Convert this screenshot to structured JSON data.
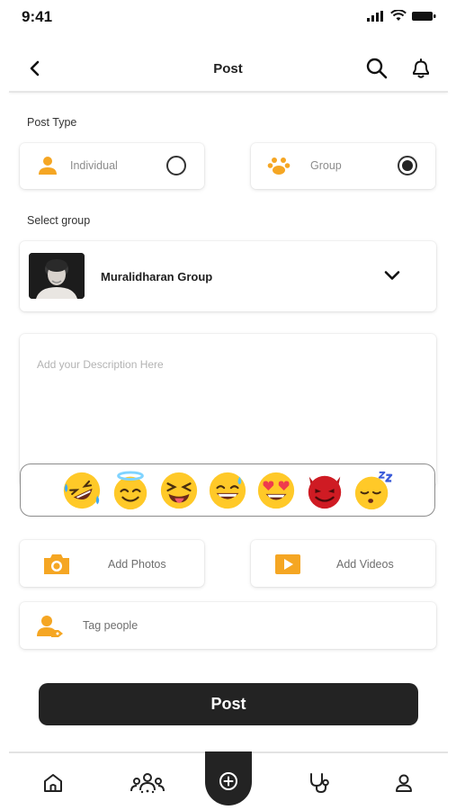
{
  "status_bar": {
    "time": "9:41"
  },
  "header": {
    "title": "Post"
  },
  "post_type": {
    "label": "Post Type",
    "options": [
      {
        "label": "Individual",
        "selected": false,
        "icon": "person-icon"
      },
      {
        "label": "Group",
        "selected": true,
        "icon": "group-paw-icon"
      }
    ]
  },
  "group": {
    "label": "Select group",
    "selected_name": "Muralidharan Group"
  },
  "description": {
    "placeholder": "Add your Description Here"
  },
  "emojis": [
    "rolling-laugh",
    "smiling-halo",
    "squinting-tongue",
    "grinning-sweat",
    "heart-eyes",
    "smiling-devil",
    "sleeping"
  ],
  "actions": {
    "add_photos": "Add Photos",
    "add_videos": "Add Videos",
    "tag_people": "Tag people"
  },
  "submit": {
    "label": "Post"
  },
  "bottom_nav": {
    "items": [
      "home-icon",
      "community-icon",
      "add-post-icon",
      "stethoscope-icon",
      "profile-icon"
    ]
  },
  "colors": {
    "accent": "#F5A623",
    "dark": "#232323"
  }
}
